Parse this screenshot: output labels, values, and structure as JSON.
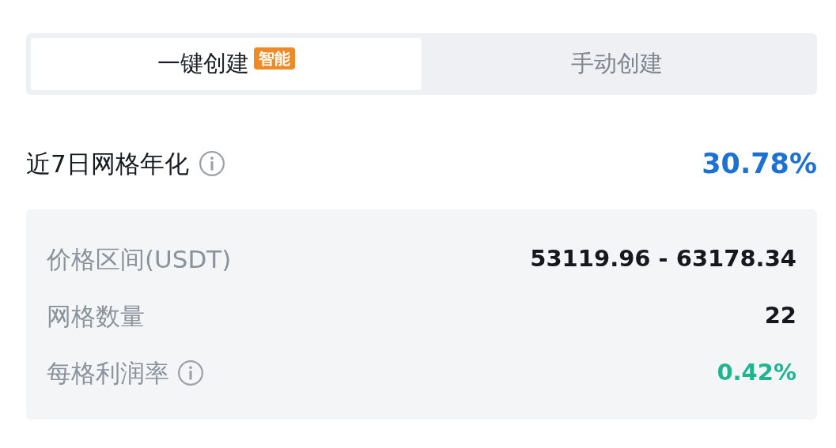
{
  "tabs": [
    {
      "label": "一键创建",
      "badge": "智能",
      "selected": true
    },
    {
      "label": "手动创建",
      "selected": false
    }
  ],
  "headline": {
    "label": "近7日网格年化",
    "info": true,
    "value": "30.78%"
  },
  "details": [
    {
      "label": "价格区间(USDT)",
      "info": false,
      "value": "53119.96 - 63178.34",
      "kind": "plain"
    },
    {
      "label": "网格数量",
      "info": false,
      "value": "22",
      "kind": "plain"
    },
    {
      "label": "每格利润率",
      "info": true,
      "value": "0.42%",
      "kind": "gain"
    }
  ]
}
